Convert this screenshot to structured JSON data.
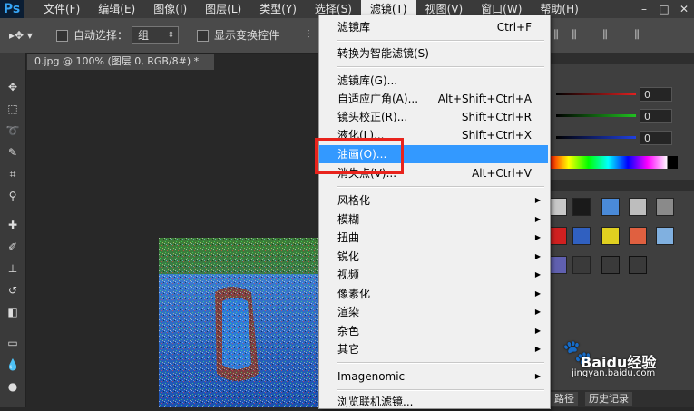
{
  "app": {
    "logo": "Ps"
  },
  "menubar": {
    "items": [
      {
        "label": "文件(F)"
      },
      {
        "label": "编辑(E)"
      },
      {
        "label": "图像(I)"
      },
      {
        "label": "图层(L)"
      },
      {
        "label": "类型(Y)"
      },
      {
        "label": "选择(S)"
      },
      {
        "label": "滤镜(T)"
      },
      {
        "label": "视图(V)"
      },
      {
        "label": "窗口(W)"
      },
      {
        "label": "帮助(H)"
      }
    ],
    "win_controls": [
      "–",
      "□",
      "✕"
    ]
  },
  "options": {
    "auto_select_label": "自动选择：",
    "auto_select_value": "组",
    "show_transform_label": "显示变换控件"
  },
  "document": {
    "tab_title": "0.jpg @ 100% (图层 0, RGB/8#) *"
  },
  "filter_menu": {
    "items": [
      {
        "label": "滤镜库",
        "shortcut": "Ctrl+F"
      },
      {
        "label": "转换为智能滤镜(S)",
        "shortcut": ""
      },
      {
        "label": "滤镜库(G)...",
        "shortcut": ""
      },
      {
        "label": "自适应广角(A)...",
        "shortcut": "Alt+Shift+Ctrl+A"
      },
      {
        "label": "镜头校正(R)...",
        "shortcut": "Shift+Ctrl+R"
      },
      {
        "label": "液化(L)...",
        "shortcut": "Shift+Ctrl+X"
      },
      {
        "label": "油画(O)...",
        "shortcut": ""
      },
      {
        "label": "消失点(V)...",
        "shortcut": "Alt+Ctrl+V"
      },
      {
        "label": "风格化",
        "shortcut": ""
      },
      {
        "label": "模糊",
        "shortcut": ""
      },
      {
        "label": "扭曲",
        "shortcut": ""
      },
      {
        "label": "锐化",
        "shortcut": ""
      },
      {
        "label": "视频",
        "shortcut": ""
      },
      {
        "label": "像素化",
        "shortcut": ""
      },
      {
        "label": "渲染",
        "shortcut": ""
      },
      {
        "label": "杂色",
        "shortcut": ""
      },
      {
        "label": "其它",
        "shortcut": ""
      },
      {
        "label": "Imagenomic",
        "shortcut": ""
      },
      {
        "label": "浏览联机滤镜...",
        "shortcut": ""
      }
    ],
    "highlighted": "油画(O)..."
  },
  "color_panel": {
    "r": "0",
    "g": "0",
    "b": "0",
    "colors": {
      "r": "#e02020",
      "g": "#20c020",
      "b": "#2040e0"
    }
  },
  "bottom_tabs": [
    "路径",
    "历史记录"
  ],
  "watermark": {
    "brand": "Baidu经验",
    "url": "jingyan.baidu.com"
  }
}
